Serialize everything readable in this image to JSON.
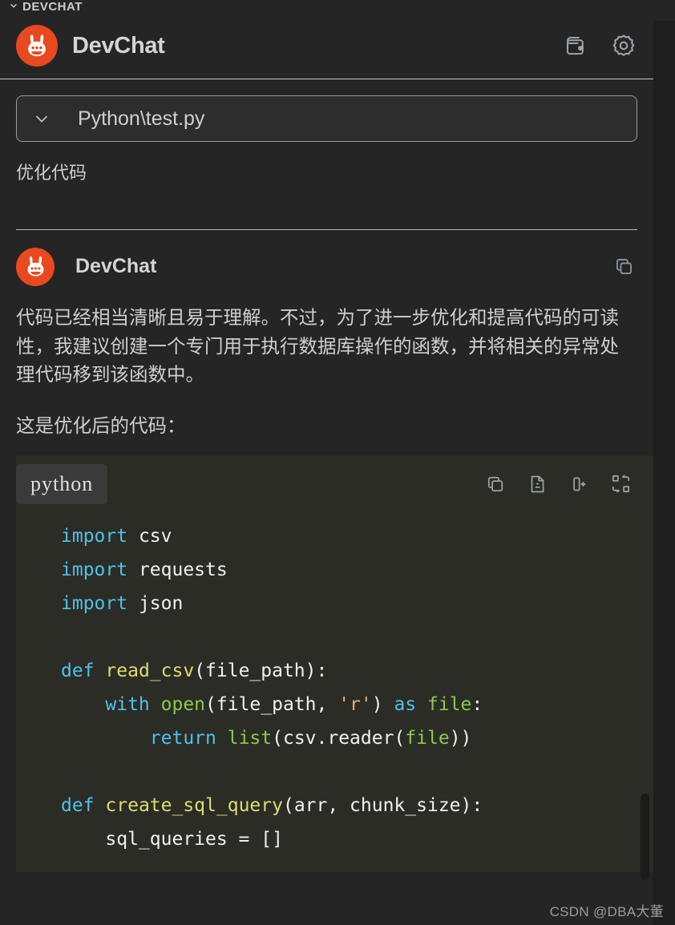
{
  "section": {
    "title": "DEVCHAT",
    "chevron_icon": "chevron-down-icon"
  },
  "header": {
    "brand": "DevChat",
    "logo_icon": "devchat-rabbit-logo",
    "logo_color": "#E8491F",
    "actions": [
      {
        "name": "wallet-button",
        "icon": "wallet-icon"
      },
      {
        "name": "settings-button",
        "icon": "gear-icon"
      }
    ]
  },
  "file_selector": {
    "value": "Python\\test.py",
    "chevron_icon": "chevron-down-icon"
  },
  "user_message": {
    "text": "优化代码"
  },
  "assistant_message": {
    "name": "DevChat",
    "copy_icon": "copy-icon",
    "paragraphs": [
      "代码已经相当清晰且易于理解。不过，为了进一步优化和提高代码的可读性，我建议创建一个专门用于执行数据库操作的函数，并将相关的异常处理代码移到该函数中。",
      "这是优化后的代码："
    ]
  },
  "code_block": {
    "language": "python",
    "actions": [
      {
        "name": "copy-code-button",
        "icon": "copy-icon"
      },
      {
        "name": "insert-to-file-button",
        "icon": "file-diff-icon"
      },
      {
        "name": "new-file-button",
        "icon": "insert-column-icon"
      },
      {
        "name": "view-diff-button",
        "icon": "diff-compare-icon"
      }
    ],
    "lines": [
      {
        "tokens": [
          {
            "t": "import",
            "c": "kw"
          },
          {
            "t": " csv",
            "c": "plain"
          }
        ]
      },
      {
        "tokens": [
          {
            "t": "import",
            "c": "kw"
          },
          {
            "t": " requests",
            "c": "plain"
          }
        ]
      },
      {
        "tokens": [
          {
            "t": "import",
            "c": "kw"
          },
          {
            "t": " json",
            "c": "plain"
          }
        ]
      },
      {
        "tokens": []
      },
      {
        "tokens": [
          {
            "t": "def",
            "c": "kw"
          },
          {
            "t": " ",
            "c": "plain"
          },
          {
            "t": "read_csv",
            "c": "fn"
          },
          {
            "t": "(file_path):",
            "c": "plain"
          }
        ]
      },
      {
        "tokens": [
          {
            "t": "    ",
            "c": "plain"
          },
          {
            "t": "with",
            "c": "kw"
          },
          {
            "t": " ",
            "c": "plain"
          },
          {
            "t": "open",
            "c": "bi"
          },
          {
            "t": "(file_path, ",
            "c": "plain"
          },
          {
            "t": "'r'",
            "c": "str"
          },
          {
            "t": ") ",
            "c": "plain"
          },
          {
            "t": "as",
            "c": "kw"
          },
          {
            "t": " ",
            "c": "plain"
          },
          {
            "t": "file",
            "c": "bi"
          },
          {
            "t": ":",
            "c": "plain"
          }
        ]
      },
      {
        "tokens": [
          {
            "t": "        ",
            "c": "plain"
          },
          {
            "t": "return",
            "c": "kw"
          },
          {
            "t": " ",
            "c": "plain"
          },
          {
            "t": "list",
            "c": "bi"
          },
          {
            "t": "(csv.reader(",
            "c": "plain"
          },
          {
            "t": "file",
            "c": "bi"
          },
          {
            "t": "))",
            "c": "plain"
          }
        ]
      },
      {
        "tokens": []
      },
      {
        "tokens": [
          {
            "t": "def",
            "c": "kw"
          },
          {
            "t": " ",
            "c": "plain"
          },
          {
            "t": "create_sql_query",
            "c": "fn"
          },
          {
            "t": "(arr, chunk_size):",
            "c": "plain"
          }
        ]
      },
      {
        "tokens": [
          {
            "t": "    sql_queries = []",
            "c": "plain"
          }
        ]
      }
    ]
  },
  "watermark": {
    "text": "CSDN @DBA大董"
  }
}
